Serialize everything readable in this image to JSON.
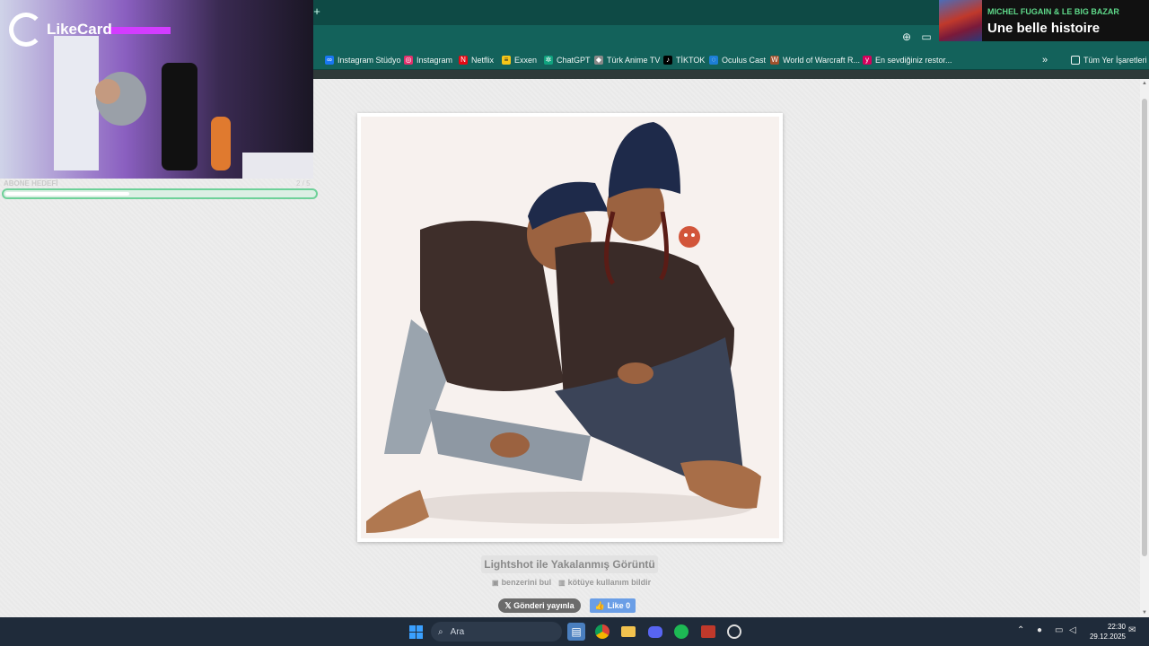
{
  "browser": {
    "new_tab_glyph": "+",
    "toolbar_icons": [
      "zoom-icon",
      "cast-icon"
    ],
    "bookmarks": [
      {
        "label": "Instagram Stüdyo",
        "icon": "meta-icon",
        "color": "#1877f2"
      },
      {
        "label": "Instagram",
        "icon": "instagram-icon",
        "color": "#e1306c"
      },
      {
        "label": "Netflix",
        "icon": "netflix-icon",
        "color": "#e50914"
      },
      {
        "label": "Exxen",
        "icon": "exxen-icon",
        "color": "#f5c518"
      },
      {
        "label": "ChatGPT",
        "icon": "chatgpt-icon",
        "color": "#10a37f"
      },
      {
        "label": "Türk Anime TV",
        "icon": "anime-icon",
        "color": "#888888"
      },
      {
        "label": "TİKTOK",
        "icon": "tiktok-icon",
        "color": "#000000"
      },
      {
        "label": "Oculus Cast",
        "icon": "oculus-icon",
        "color": "#1c7ed6"
      },
      {
        "label": "World of Warcraft R...",
        "icon": "wow-icon",
        "color": "#a0522d"
      },
      {
        "label": "En sevdiğiniz restor...",
        "icon": "yemeksepeti-icon",
        "color": "#d6005c"
      }
    ],
    "more_bookmarks_glyph": "»",
    "all_bookmarks_label": "Tüm Yer İşaretleri"
  },
  "webcam": {
    "logo_text": "LikeCard",
    "donation_label": "ABONE HEDEFİ",
    "donation_count": "2 / 5",
    "progress": 0.4
  },
  "music": {
    "artist": "MICHEL FUGAIN & LE BIG BAZAR",
    "title": "Une belle histoire"
  },
  "page": {
    "caption": "Lightshot ile Yakalanmış Görüntü",
    "find_similar": "benzerini bul",
    "report_abuse": "kötüye kullanım bildir",
    "share_x": "Gönderi yayınla",
    "like": "Like 0"
  },
  "taskbar": {
    "search_placeholder": "Ara",
    "time": "22:30",
    "date": "29.12.2025"
  },
  "colors": {
    "tab_bar": "#0e4a45",
    "toolbar": "#13625b",
    "progress_border": "#6ed199",
    "music_artist": "#5fd98a",
    "like_button": "#6a9ee6"
  }
}
